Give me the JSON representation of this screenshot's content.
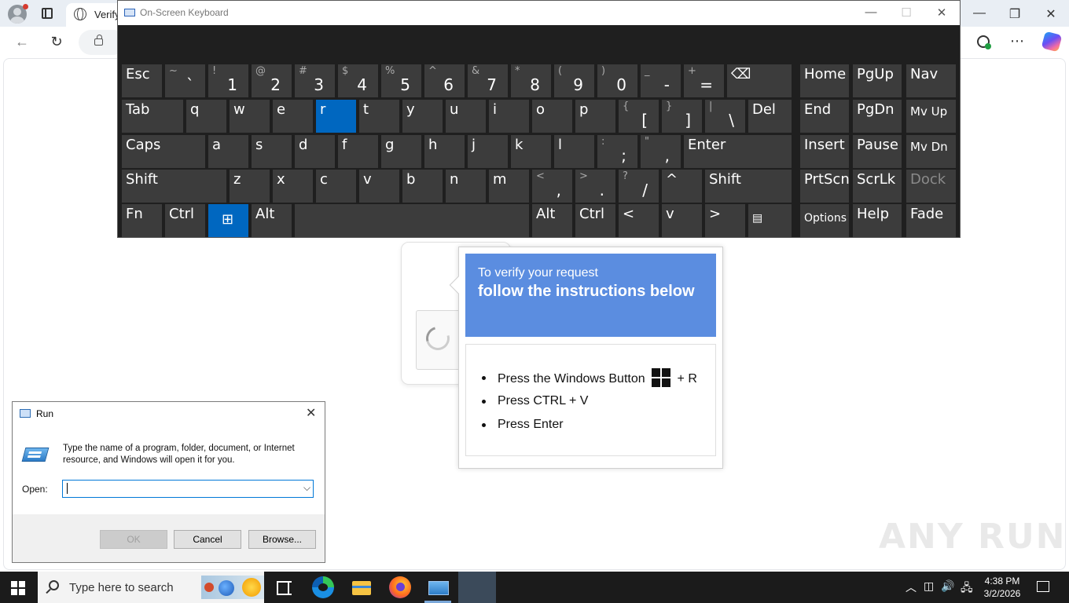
{
  "browser": {
    "tab_title": "Verify",
    "controls": {
      "minimize": "—",
      "restore": "❐",
      "close": "✕"
    },
    "toolbar": {
      "back": "←",
      "reload": "↻",
      "more": "⋯"
    }
  },
  "osk": {
    "title": "On-Screen Keyboard",
    "controls": {
      "minimize": "—",
      "maximize": "☐",
      "close": "✕"
    },
    "keys": [
      {
        "l": "Esc"
      },
      {
        "s": "~",
        "m": "`"
      },
      {
        "s": "!",
        "m": "1"
      },
      {
        "s": "@",
        "m": "2"
      },
      {
        "s": "#",
        "m": "3"
      },
      {
        "s": "$",
        "m": "4"
      },
      {
        "s": "%",
        "m": "5"
      },
      {
        "s": "^",
        "m": "6"
      },
      {
        "s": "&",
        "m": "7"
      },
      {
        "s": "*",
        "m": "8"
      },
      {
        "s": "(",
        "m": "9"
      },
      {
        "s": ")",
        "m": "0"
      },
      {
        "s": "_",
        "m": "-"
      },
      {
        "s": "+",
        "m": "="
      },
      {
        "l": "⌫"
      },
      {
        "l": "Home"
      },
      {
        "l": "PgUp"
      },
      {
        "l": "Nav"
      },
      {
        "l": "Tab"
      },
      {
        "l": "q"
      },
      {
        "l": "w"
      },
      {
        "l": "e"
      },
      {
        "l": "r"
      },
      {
        "l": "t"
      },
      {
        "l": "y"
      },
      {
        "l": "u"
      },
      {
        "l": "i"
      },
      {
        "l": "o"
      },
      {
        "l": "p"
      },
      {
        "s": "{",
        "m": "["
      },
      {
        "s": "}",
        "m": "]"
      },
      {
        "s": "|",
        "m": "\\"
      },
      {
        "l": "Del"
      },
      {
        "l": "End"
      },
      {
        "l": "PgDn"
      },
      {
        "l": "Mv Up"
      },
      {
        "l": "Caps"
      },
      {
        "l": "a"
      },
      {
        "l": "s"
      },
      {
        "l": "d"
      },
      {
        "l": "f"
      },
      {
        "l": "g"
      },
      {
        "l": "h"
      },
      {
        "l": "j"
      },
      {
        "l": "k"
      },
      {
        "l": "l"
      },
      {
        "s": ":",
        "m": ";"
      },
      {
        "s": "\"",
        "m": ","
      },
      {
        "l": "Enter"
      },
      {
        "l": "Insert"
      },
      {
        "l": "Pause"
      },
      {
        "l": "Mv Dn"
      },
      {
        "l": "Shift"
      },
      {
        "l": "z"
      },
      {
        "l": "x"
      },
      {
        "l": "c"
      },
      {
        "l": "v"
      },
      {
        "l": "b"
      },
      {
        "l": "n"
      },
      {
        "l": "m"
      },
      {
        "s": "<",
        "m": ","
      },
      {
        "s": ">",
        "m": "."
      },
      {
        "s": "?",
        "m": "/"
      },
      {
        "l": "^"
      },
      {
        "l": "Shift"
      },
      {
        "l": "PrtScn"
      },
      {
        "l": "ScrLk"
      },
      {
        "l": "Dock"
      },
      {
        "l": "Fn"
      },
      {
        "l": "Ctrl"
      },
      {
        "l": "⊞"
      },
      {
        "l": "Alt"
      },
      {
        "l": ""
      },
      {
        "l": "Alt"
      },
      {
        "l": "Ctrl"
      },
      {
        "l": "<"
      },
      {
        "l": "v"
      },
      {
        "l": ">"
      },
      {
        "l": "▤"
      },
      {
        "l": "Options"
      },
      {
        "l": "Help"
      },
      {
        "l": "Fade"
      }
    ],
    "highlighted_keys": [
      "r",
      "windows"
    ]
  },
  "verify_popup": {
    "header_small": "To verify your request",
    "header_big": "follow the instructions below",
    "steps": [
      {
        "before": "Press the Windows Button",
        "after": "+ R"
      },
      {
        "before": "Press CTRL + V",
        "after": ""
      },
      {
        "before": "Press Enter",
        "after": ""
      }
    ],
    "accent_color": "#5b8de0"
  },
  "run_dialog": {
    "title": "Run",
    "close": "✕",
    "description": "Type the name of a program, folder, document, or Internet resource, and Windows will open it for you.",
    "open_label": "Open:",
    "open_value": "",
    "dropdown": "⌵",
    "ok_label": "OK",
    "cancel_label": "Cancel",
    "browse_label": "Browse..."
  },
  "watermark": "ANY RUN",
  "taskbar": {
    "search_placeholder": "Type here to search",
    "tray": {
      "chevron": "︿",
      "volume": "🔊",
      "network": "🖧",
      "meet": "◫"
    },
    "time": "4:38 PM",
    "date": "3/2/2026"
  }
}
